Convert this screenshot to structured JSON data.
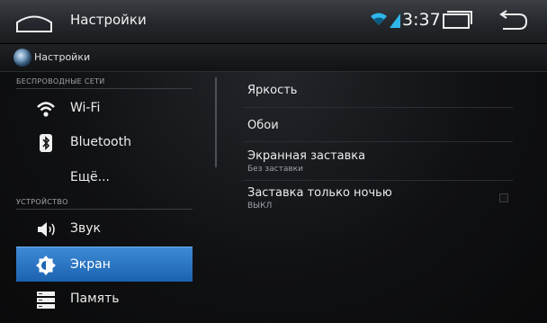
{
  "topbar": {
    "title": "Настройки",
    "time": "3:37"
  },
  "subbar": {
    "title": "Настройки"
  },
  "sidebar": {
    "sections": [
      {
        "label": "БЕСПРОВОДНЫЕ СЕТИ"
      },
      {
        "label": "УСТРОЙСТВО"
      }
    ],
    "items": [
      {
        "label": "Wi-Fi",
        "icon": "wifi-icon"
      },
      {
        "label": "Bluetooth",
        "icon": "bluetooth-icon"
      },
      {
        "label": "Ещё..."
      },
      {
        "label": "Звук",
        "icon": "speaker-icon"
      },
      {
        "label": "Экран",
        "icon": "brightness-icon",
        "active": true
      },
      {
        "label": "Память",
        "icon": "storage-icon"
      }
    ]
  },
  "display": {
    "prefs": [
      {
        "title": "Яркость"
      },
      {
        "title": "Обои"
      },
      {
        "title": "Экранная заставка",
        "summary": "Без заставки"
      },
      {
        "title": "Заставка только ночью",
        "summary": "ВЫКЛ",
        "checked": false
      }
    ]
  },
  "colors": {
    "accent": "#2f7bd0",
    "background": "#0c0c0f"
  }
}
